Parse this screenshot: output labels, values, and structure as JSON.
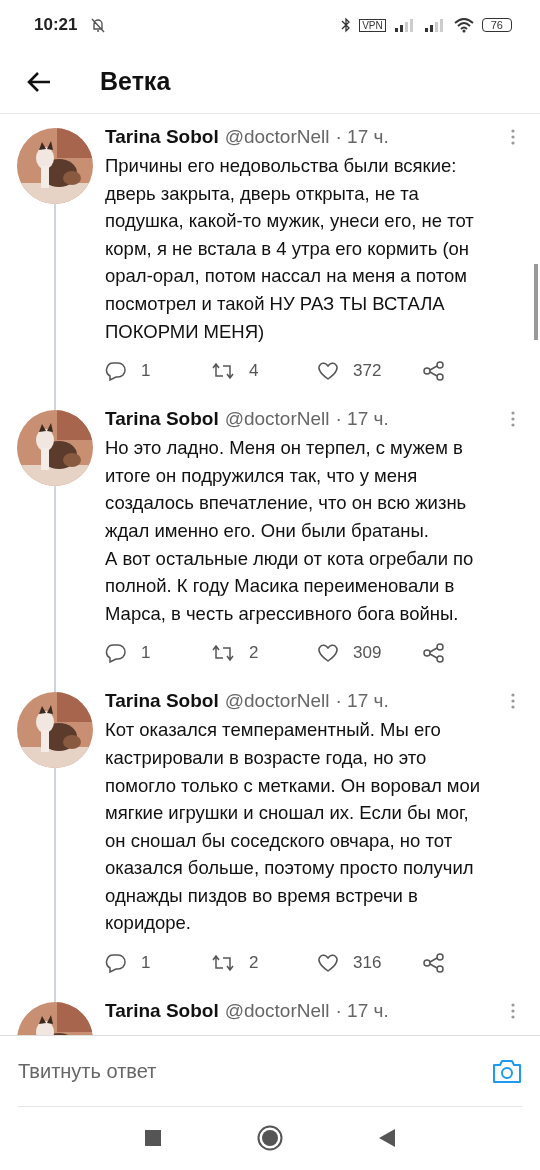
{
  "status_bar": {
    "time": "10:21",
    "vpn": "VPN",
    "battery": "76"
  },
  "header": {
    "title": "Ветка"
  },
  "tweets": [
    {
      "name": "Tarina Sobol",
      "handle": "@doctorNell",
      "time": "· 17 ч.",
      "text": "Причины его недовольства были всякие: дверь закрыта, дверь открыта, не та подушка, какой-то мужик, унеси его, не тот корм, я не встала в 4 утра его кормить (он орал-орал, потом нассал на меня а потом посмотрел и такой НУ РАЗ ТЫ ВСТАЛА ПОКОРМИ МЕНЯ)",
      "replies": "1",
      "retweets": "4",
      "likes": "372"
    },
    {
      "name": "Tarina Sobol",
      "handle": "@doctorNell",
      "time": "· 17 ч.",
      "text": "Но это ладно. Меня он терпел, с мужем в итоге он подружился так, что у меня создалось впечатление, что он всю жизнь ждал именно его. Они были братаны.\nА вот остальные люди от кота огребали по полной. К году Масика переименовали в Марса, в честь агрессивного бога войны.",
      "replies": "1",
      "retweets": "2",
      "likes": "309"
    },
    {
      "name": "Tarina Sobol",
      "handle": "@doctorNell",
      "time": "· 17 ч.",
      "text": "Кот оказался темпераментный. Мы его кастрировали в возрасте года, но это помогло только с метками. Он воровал мои мягкие игрушки и сношал их. Если бы мог, он сношал бы соседского овчара, но тот оказался больше, поэтому просто получил однажды пиздов во время встречи в коридоре.",
      "replies": "1",
      "retweets": "2",
      "likes": "316"
    },
    {
      "name": "Tarina Sobol",
      "handle": "@doctorNell",
      "time": "· 17 ч."
    }
  ],
  "reply_field": {
    "placeholder": "Твитнуть ответ"
  }
}
